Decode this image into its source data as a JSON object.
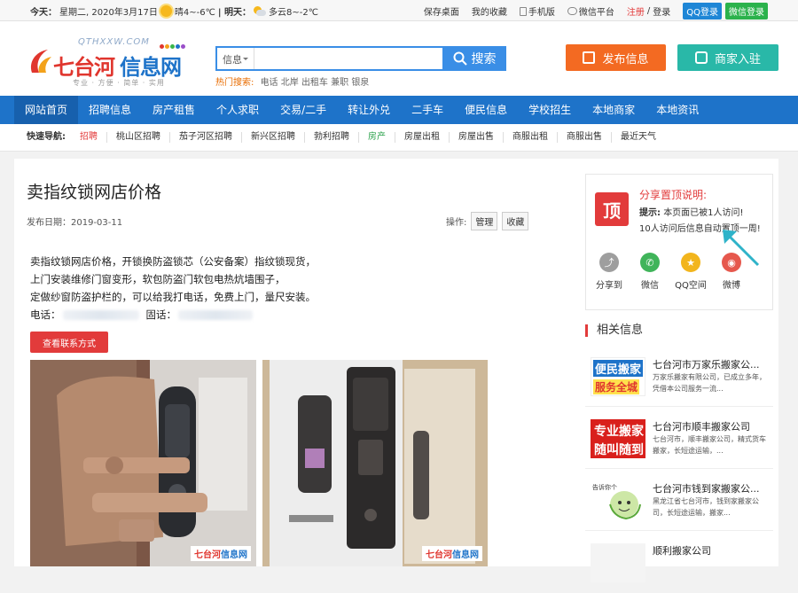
{
  "topbar": {
    "today_label": "今天：",
    "date": "星期二, 2020年3月17日",
    "weather_today": "晴4~-6℃",
    "tomorrow_label": "| 明天：",
    "weather_tomorrow": "多云8~-2℃",
    "links": [
      "保存桌面",
      "我的收藏",
      "手机版",
      "微信平台"
    ],
    "register": "注册",
    "sep": "/",
    "login": "登录",
    "qq_login": "QQ登录",
    "wx_login": "微信登录"
  },
  "header": {
    "logo_domain": "QTHXXW.COM",
    "logo_name_red": "七台河",
    "logo_name_blue": "信息网",
    "logo_slogan": "专业 · 方便 · 简单 · 实用",
    "search_category": "信息",
    "search_placeholder": "",
    "search_button": "搜索",
    "hot_label": "热门搜索:",
    "hot_keywords": [
      "电话",
      "北岸",
      "出租车",
      "兼职",
      "银泉"
    ],
    "publish_button": "发布信息",
    "merchant_button": "商家入驻"
  },
  "nav": {
    "items": [
      "网站首页",
      "招聘信息",
      "房产租售",
      "个人求职",
      "交易/二手",
      "转让外兑",
      "二手车",
      "便民信息",
      "学校招生",
      "本地商家",
      "本地资讯"
    ]
  },
  "quick_nav": {
    "label": "快速导航:",
    "items": [
      "招聘",
      "桃山区招聘",
      "茄子河区招聘",
      "新兴区招聘",
      "勃利招聘",
      "房产",
      "房屋出租",
      "房屋出售",
      "商服出租",
      "商服出售",
      "最近天气"
    ]
  },
  "article": {
    "title": "卖指纹锁网店价格",
    "date": "发布日期：2019-03-11",
    "ops_label": "操作:",
    "ops_manage": "管理",
    "ops_fav": "收藏",
    "lines": [
      "卖指纹锁网店价格，开锁换防盗锁芯（公安备案）指纹锁现货，",
      "上门安装维修门窗变形，软包防盗门软包电热炕墙围子，",
      "定做纱窗防盗护栏的，可以给我打电话，免费上门，量尺安装。"
    ],
    "phone_label": "电话：",
    "tel_label": "固话：",
    "contact_button": "查看联系方式",
    "watermark_red": "七台河",
    "watermark_blue": "信息网"
  },
  "share": {
    "badge": "顶",
    "heading": "分享置顶说明:",
    "line1_label": "提示:",
    "line1_text": "本页面已被1人访问!",
    "line2": "10人访问后信息自动置顶一周!",
    "icons": [
      {
        "name": "分享到",
        "color": "#9e9e9e",
        "glyph": "⤴"
      },
      {
        "name": "微信",
        "color": "#40b45a",
        "glyph": "✆"
      },
      {
        "name": "QQ空间",
        "color": "#f2b51d",
        "glyph": "★"
      },
      {
        "name": "微博",
        "color": "#e6584d",
        "glyph": "◉"
      }
    ]
  },
  "related": {
    "title": "相关信息",
    "items": [
      {
        "title": "七台河市万家乐搬家公...",
        "desc": "万家乐搬家有限公司，已成立多年，凭借本公司服务一流..."
      },
      {
        "title": "七台河市顺丰搬家公司",
        "desc": "七台河市，顺丰搬家公司，精式货车搬家，长短途运输，..."
      },
      {
        "title": "七台河市钱到家搬家公...",
        "desc": "黑龙江省七台河市，钱到家搬家公司，长短途运输，搬家..."
      },
      {
        "title": "顺利搬家公司",
        "desc": ""
      }
    ],
    "thumb1_a": "便民搬家",
    "thumb1_b": "服务全城",
    "thumb2_a": "专业搬家",
    "thumb2_b": "随叫随到",
    "thumb3": "告诉你个"
  }
}
